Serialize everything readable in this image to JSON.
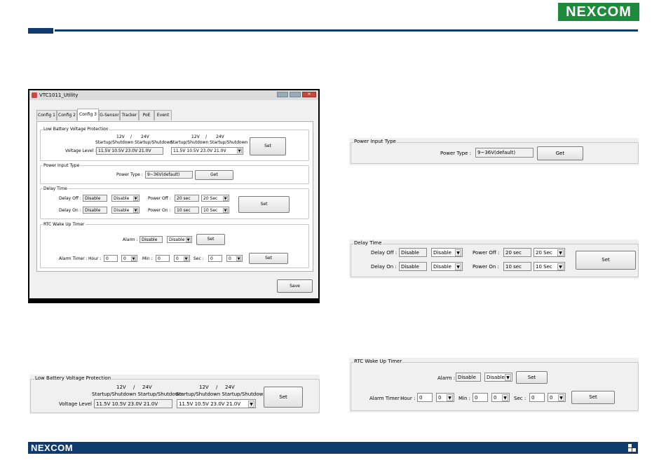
{
  "brand": {
    "logo": "NEXCOM",
    "footer_logo": "NEXCOM"
  },
  "window": {
    "title": "VTC1011_Utility",
    "tabs": [
      "Config 1",
      "Config 2",
      "Config 3",
      "G-Sensor",
      "Tracker",
      "PoE",
      "Event"
    ],
    "active_tab": "Config 3",
    "save_label": "Save"
  },
  "low_battery": {
    "title": "Low Battery Voltage Protection",
    "h12": "12V",
    "slash": "/",
    "h24": "24V",
    "sub": "Startup/Shutdown Startup/Shutdown",
    "voltage_label": "Voltage Level :",
    "values1": "11.5V  10.5V   23.0V  21.0V",
    "values2": "11.5V  10.5V   23.0V  21.0V",
    "set": "Set"
  },
  "power_input": {
    "title": "Power Input Type",
    "label": "Power Type :",
    "value": "9~36V(default)",
    "get": "Get"
  },
  "delay": {
    "title": "Delay Time",
    "off_label": "Delay Off :",
    "on_label": "Delay On :",
    "off_value": "Disable",
    "on_value": "Disable",
    "off_sel": "Disable",
    "on_sel": "Disable",
    "poff_label": "Power Off :",
    "pon_label": "Power On :",
    "poff_value": "20 sec",
    "pon_value": "10 sec",
    "poff_sel": "20 Sec",
    "pon_sel": "10 Sec",
    "set": "Set"
  },
  "rtc": {
    "title": "RTC Wake Up Timer",
    "alarm_label": "Alarm :",
    "alarm_value": "Disable",
    "alarm_sel": "Disable",
    "set": "Set",
    "timer_label": "Alarm Timer :",
    "hour_label": "Hour :",
    "min_label": "Min :",
    "sec_label": "Sec :",
    "hour_value": "0",
    "hour_sel": "0",
    "min_value": "0",
    "min_sel": "0",
    "sec_value": "0",
    "sec_sel": "0",
    "set2": "Set"
  }
}
